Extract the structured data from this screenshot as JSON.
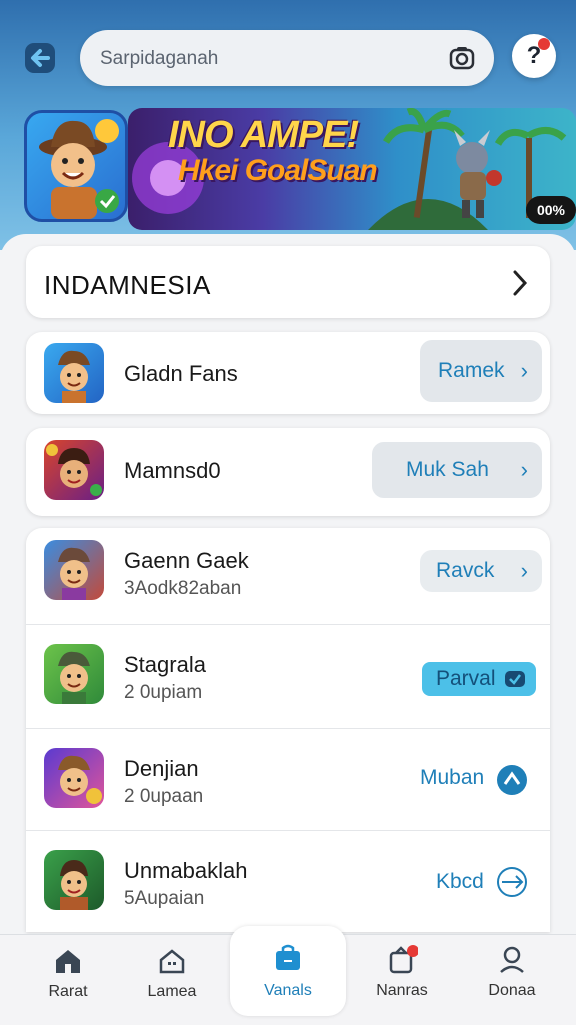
{
  "search": {
    "text": "Sarpidaganah"
  },
  "banner": {
    "title": "INO AMPE!",
    "subtitle": "Hkei GoalSuan",
    "badge": "00%"
  },
  "country": {
    "label": "INDAMNESIA"
  },
  "apps": [
    {
      "name": "Gladn Fans",
      "sub": "",
      "action": "Ramek"
    },
    {
      "name": "Mamnsd0",
      "sub": "",
      "action": "Muk Sah"
    },
    {
      "name": "Gaenn Gaek",
      "sub": "3Aodk82aban",
      "action": "Ravck"
    },
    {
      "name": "Stagrala",
      "sub": "2 0upiam",
      "action": "Parval"
    },
    {
      "name": "Denjian",
      "sub": "2 0upaan",
      "action": "Muban"
    },
    {
      "name": "Unmabaklah",
      "sub": "5Aupaian",
      "action": "Kbcd"
    }
  ],
  "nav": [
    {
      "label": "Rarat",
      "icon": "home-icon"
    },
    {
      "label": "Lamea",
      "icon": "house-icon"
    },
    {
      "label": "Vanals",
      "icon": "bag-icon"
    },
    {
      "label": "Nanras",
      "icon": "notifications-icon"
    },
    {
      "label": "Donaa",
      "icon": "profile-icon"
    }
  ],
  "colors": {
    "accent": "#1f7fb8",
    "header": "#3d86c6",
    "badge": "#e53935"
  }
}
